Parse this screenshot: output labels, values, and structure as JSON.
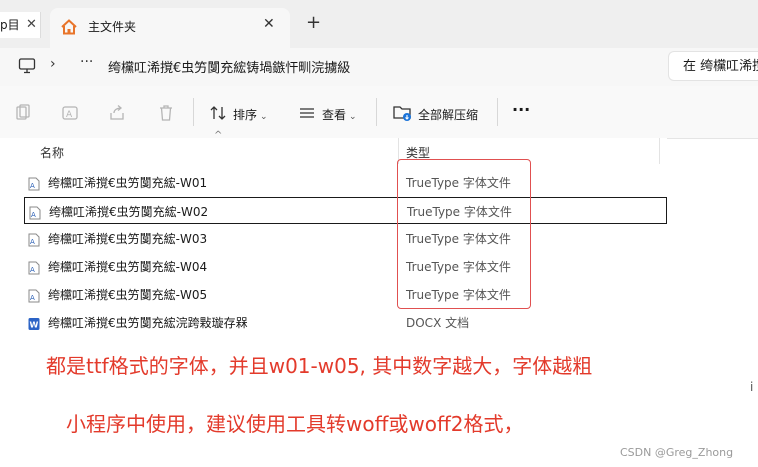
{
  "tabs": {
    "prev": {
      "label": "p目",
      "close": "✕"
    },
    "active": {
      "label": "主文件夹",
      "close": "✕"
    },
    "new_tab": "+"
  },
  "address": {
    "chevron": "›",
    "more": "···",
    "path": "绔欓叿浠撹€虫竻闅充綋铸堝鏃忓甽浣擄級",
    "search_placeholder": "在 绔欓叿浠撹"
  },
  "toolbar": {
    "sort_label": "排序",
    "view_label": "查看",
    "extract_label": "全部解压缩",
    "more_label": "···"
  },
  "columns": {
    "name": "名称",
    "type": "类型"
  },
  "files": [
    {
      "name": "绔欓叿浠撹€虫竻闅充綋-W01",
      "type": "TrueType 字体文件",
      "icon": "font-file-icon"
    },
    {
      "name": "绔欓叿浠撹€虫竻闅充綋-W02",
      "type": "TrueType 字体文件",
      "icon": "font-file-icon"
    },
    {
      "name": "绔欓叿浠撹€虫竻闅充綋-W03",
      "type": "TrueType 字体文件",
      "icon": "font-file-icon"
    },
    {
      "name": "绔欓叿浠撹€虫竻闅充綋-W04",
      "type": "TrueType 字体文件",
      "icon": "font-file-icon"
    },
    {
      "name": "绔欓叿浠撹€虫竻闅充綋-W05",
      "type": "TrueType 字体文件",
      "icon": "font-file-icon"
    },
    {
      "name": "绔欓叿浠撹€虫竻闅充綋浣跨敤璇存槑",
      "type": "DOCX 文档",
      "icon": "word-doc-icon"
    }
  ],
  "annotations": {
    "line1": "都是ttf格式的字体，并且w01-w05, 其中数字越大，字体越粗",
    "line2": "小程序中使用，建议使用工具转woff或woff2格式，"
  },
  "watermark": "CSDN @Greg_Zhong",
  "colors": {
    "annotation_red": "#e33a2b",
    "highlight_box": "#e05050",
    "home_orange": "#e8742a"
  }
}
